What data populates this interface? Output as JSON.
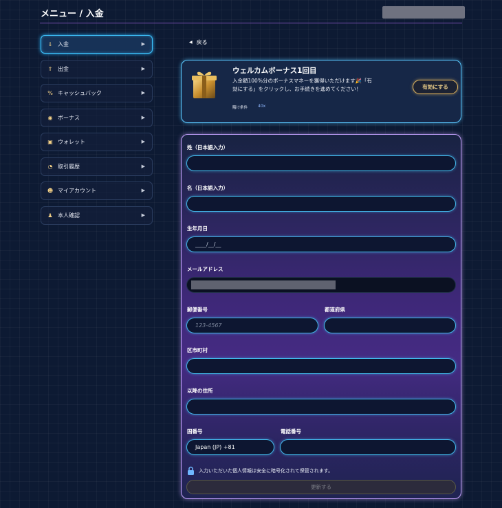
{
  "header": {
    "title": "メニュー / 入金"
  },
  "sidebar": {
    "items": [
      {
        "label": "入金",
        "icon": "deposit-icon",
        "active": true
      },
      {
        "label": "出金",
        "icon": "withdraw-icon",
        "active": false
      },
      {
        "label": "キャッシュバック",
        "icon": "percent-icon",
        "active": false
      },
      {
        "label": "ボーナス",
        "icon": "bonus-icon",
        "active": false
      },
      {
        "label": "ウォレット",
        "icon": "wallet-icon",
        "active": false
      },
      {
        "label": "取引履歴",
        "icon": "history-icon",
        "active": false
      },
      {
        "label": "マイアカウント",
        "icon": "account-icon",
        "active": false
      },
      {
        "label": "本人確認",
        "icon": "verify-icon",
        "active": false
      }
    ]
  },
  "back": {
    "label": "戻る"
  },
  "promo": {
    "title": "ウェルカムボーナス1回目",
    "description": "入金額100%分のボーナスマネーを獲得いただけます🎉「有効にする」をクリックし、お手続きを進めてください！",
    "wager_label": "賭け条件",
    "wager_value": "40x",
    "button": "有効にする"
  },
  "form": {
    "last_name": {
      "label": "姓（日本語入力）",
      "value": ""
    },
    "first_name": {
      "label": "名（日本語入力）",
      "value": ""
    },
    "birthdate": {
      "label": "生年月日",
      "value": "____/__/__"
    },
    "email": {
      "label": "メールアドレス"
    },
    "postal": {
      "label": "郵便番号",
      "placeholder": "123-4567"
    },
    "prefecture": {
      "label": "都道府県",
      "value": ""
    },
    "city": {
      "label": "区市町村",
      "value": ""
    },
    "address": {
      "label": "以降の住所",
      "value": ""
    },
    "country_code": {
      "label": "国番号",
      "value": "Japan (JP) +81"
    },
    "phone": {
      "label": "電話番号",
      "value": ""
    },
    "security_note": "入力いただいた個人情報は安全に暗号化されて保管されます。",
    "submit": "更新する"
  },
  "colors": {
    "accent": "#3fc6ff",
    "gold": "#e0b45d",
    "panel_border": "#c6a3ff"
  }
}
